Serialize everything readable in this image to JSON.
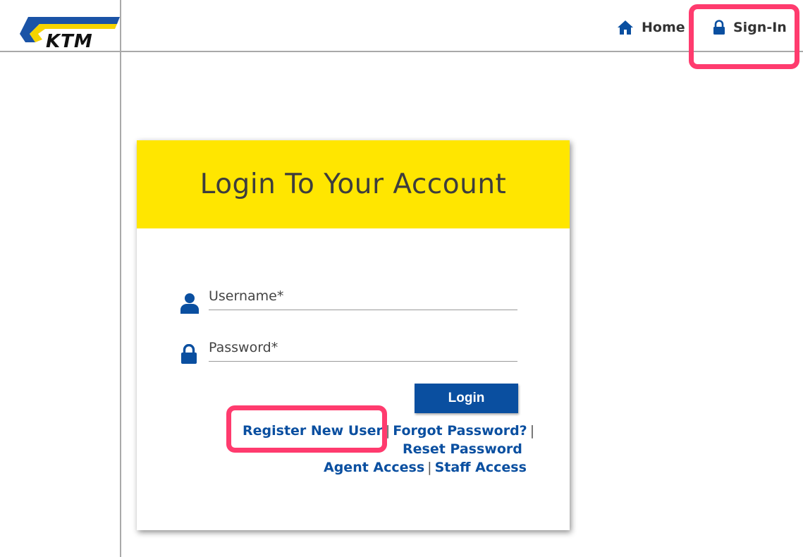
{
  "header": {
    "logo_text": "KTM",
    "nav": {
      "home_label": "Home",
      "signin_label": "Sign-In"
    }
  },
  "login_card": {
    "title": "Login To Your Account",
    "username": {
      "placeholder": "Username*",
      "value": ""
    },
    "password": {
      "placeholder": "Password*",
      "value": ""
    },
    "login_button": "Login",
    "links": {
      "register": "Register New User",
      "forgot": "Forgot Password?",
      "reset": "Reset Password",
      "agent": "Agent Access",
      "staff": "Staff Access",
      "separator": "|"
    }
  },
  "colors": {
    "brand_blue": "#0a4fa0",
    "header_yellow": "#ffe600",
    "highlight": "#ff3b6e"
  },
  "icons": [
    "home-icon",
    "lock-icon",
    "user-icon",
    "password-lock-icon"
  ]
}
